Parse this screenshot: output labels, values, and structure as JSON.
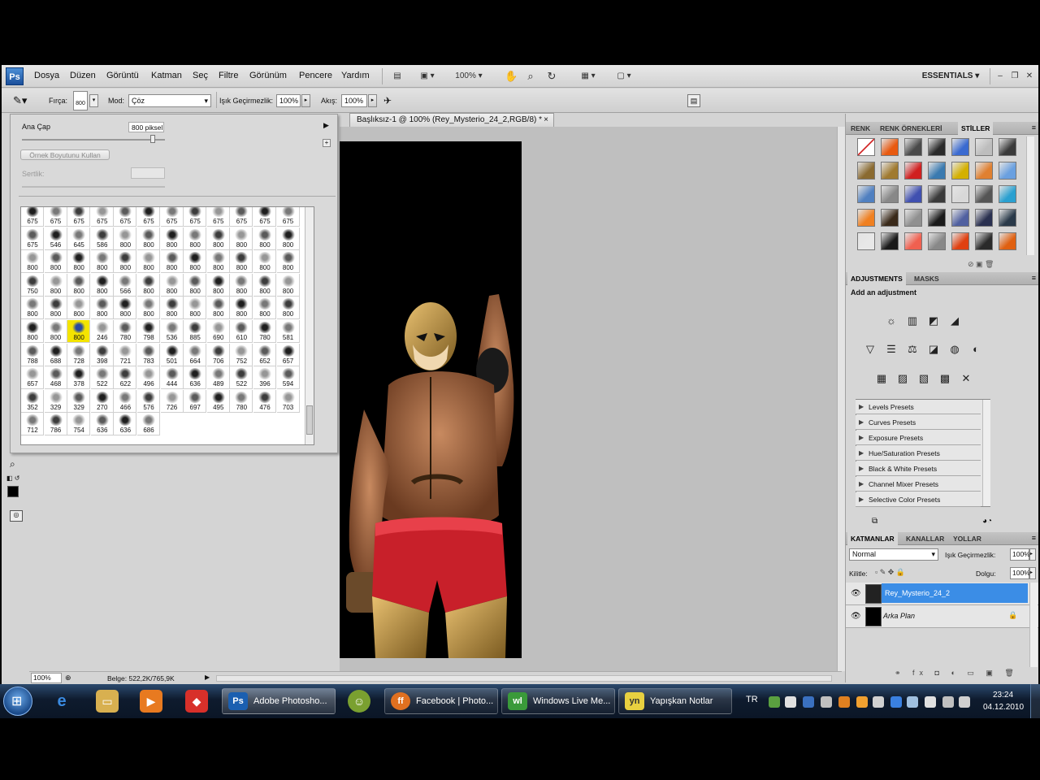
{
  "app": {
    "logo": "Ps",
    "menu": [
      "Dosya",
      "Düzen",
      "Görüntü",
      "Katman",
      "Seç",
      "Filtre",
      "Görünüm",
      "Pencere",
      "Yardım"
    ],
    "zoom": "100%",
    "workspace": "ESSENTIALS"
  },
  "options": {
    "brush_label": "Fırça:",
    "brush_size": "800",
    "mode_label": "Mod:",
    "mode_value": "Çöz",
    "opacity_label": "Işık Geçirmezlik:",
    "opacity_value": "100%",
    "flow_label": "Akış:",
    "flow_value": "100%"
  },
  "brush_panel": {
    "master_diameter_label": "Ana Çap",
    "master_diameter_value": "800 piksel",
    "sample_size_button": "Örnek Boyutunu Kullan",
    "hardness_label": "Sertlik:",
    "rows": [
      [
        "675",
        "675",
        "675",
        "675",
        "675",
        "675",
        "675",
        "675",
        "675",
        "675",
        "675",
        "675"
      ],
      [
        "675",
        "546",
        "645",
        "586",
        "800",
        "800",
        "800",
        "800",
        "800",
        "800",
        "800",
        "800"
      ],
      [
        "800",
        "800",
        "800",
        "800",
        "800",
        "800",
        "800",
        "800",
        "800",
        "800",
        "800",
        "800"
      ],
      [
        "750",
        "800",
        "800",
        "800",
        "566",
        "800",
        "800",
        "800",
        "800",
        "800",
        "800",
        "800"
      ],
      [
        "800",
        "800",
        "800",
        "800",
        "800",
        "800",
        "800",
        "800",
        "800",
        "800",
        "800",
        "800"
      ],
      [
        "800",
        "800",
        "800",
        "246",
        "780",
        "798",
        "536",
        "885",
        "690",
        "610",
        "780",
        "581"
      ],
      [
        "788",
        "688",
        "728",
        "398",
        "721",
        "783",
        "501",
        "664",
        "706",
        "752",
        "652",
        "657"
      ],
      [
        "657",
        "468",
        "378",
        "522",
        "622",
        "496",
        "444",
        "636",
        "489",
        "522",
        "396",
        "594"
      ],
      [
        "352",
        "329",
        "329",
        "270",
        "466",
        "576",
        "726",
        "697",
        "495",
        "780",
        "476",
        "703"
      ],
      [
        "712",
        "786",
        "754",
        "636",
        "636",
        "686"
      ]
    ],
    "selected_index": [
      5,
      2
    ]
  },
  "document": {
    "tab_title": "Başlıksız-1 @ 100% (Rey_Mysterio_24_2,RGB/8) *",
    "close": "×"
  },
  "status": {
    "zoom": "100%",
    "doc_size": "Belge: 522,2K/765,9K"
  },
  "styles_panel": {
    "tabs": [
      "RENK",
      "RENK ÖRNEKLERİ",
      "STİLLER"
    ],
    "swatches": [
      "#ffffff",
      "#e85a10",
      "#4a4a4a",
      "#2a2a2a",
      "#3a6ad0",
      "#bdbdbd",
      "#3a3a3a",
      "#8a6a30",
      "#a07a30",
      "#d02020",
      "#3a7ab0",
      "#d4b000",
      "#e08030",
      "#6aa0e0",
      "#5080c0",
      "#888888",
      "#4050b0",
      "#3a3a3a",
      "#d8d8d8",
      "#555555",
      "#2aa0d0",
      "#f08020",
      "#3a2a1a",
      "#909090",
      "#1a1a1a",
      "#5060a0",
      "#2a3050",
      "#2a3a4a",
      "#e8e8e8",
      "#1a1a1a",
      "#f06050",
      "#888888",
      "#e04010",
      "#2a2a2a",
      "#e06010"
    ]
  },
  "adjustments_panel": {
    "tabs": [
      "ADJUSTMENTS",
      "MASKS"
    ],
    "heading": "Add an adjustment",
    "icons_row1": [
      "☼",
      "▥",
      "◩",
      "◢"
    ],
    "icons_row2": [
      "▽",
      "☰",
      "⚖",
      "◪",
      "◍",
      "◐"
    ],
    "icons_row3": [
      "▦",
      "▨",
      "▧",
      "▩",
      "✕"
    ],
    "presets": [
      "Levels Presets",
      "Curves Presets",
      "Exposure Presets",
      "Hue/Saturation Presets",
      "Black & White Presets",
      "Channel Mixer Presets",
      "Selective Color Presets"
    ]
  },
  "layers_panel": {
    "tabs": [
      "KATMANLAR",
      "KANALLAR",
      "YOLLAR"
    ],
    "blend_mode": "Normal",
    "opacity_label": "Işık Geçirmezlik:",
    "opacity_value": "100%",
    "lock_label": "Kilitle:",
    "fill_label": "Dolgu:",
    "fill_value": "100%",
    "layers": [
      {
        "name": "Rey_Mysterio_24_2",
        "selected": true
      },
      {
        "name": "Arka Plan",
        "selected": false
      }
    ]
  },
  "taskbar": {
    "buttons": [
      {
        "label": "Adobe Photosho...",
        "icon": "Ps",
        "color": "#1b5fb0",
        "active": true
      },
      {
        "label": "Facebook | Photo...",
        "icon": "ff",
        "color": "#e07020",
        "active": false
      },
      {
        "label": "Windows Live Me...",
        "icon": "wl",
        "color": "#3a9a3a",
        "active": false
      },
      {
        "label": "Yapışkan Notlar",
        "icon": "yn",
        "color": "#e8d040",
        "active": false
      }
    ],
    "lang": "TR",
    "time": "23:24",
    "date": "04.12.2010"
  }
}
